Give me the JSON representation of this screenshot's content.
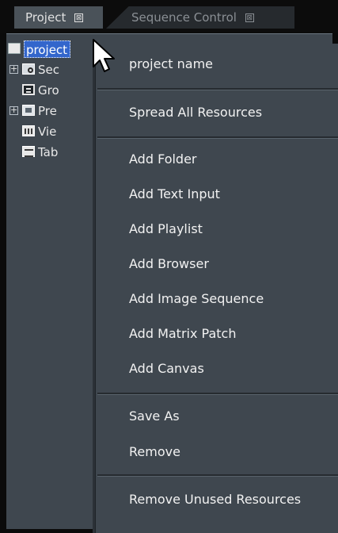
{
  "tabs": [
    {
      "label": "Project",
      "close": "⊠"
    },
    {
      "label": "Sequence Control",
      "close": "⊠"
    }
  ],
  "tree": {
    "root": {
      "label": "project",
      "icon": "open-folder-icon"
    },
    "items": [
      {
        "label": "Sec",
        "icon": "sequence-icon",
        "expandable": true,
        "expander": "+"
      },
      {
        "label": "Gro",
        "icon": "group-icon",
        "expandable": false
      },
      {
        "label": "Pre",
        "icon": "preset-icon",
        "expandable": true,
        "expander": "+"
      },
      {
        "label": "Vie",
        "icon": "view-icon",
        "expandable": false
      },
      {
        "label": "Tab",
        "icon": "table-icon",
        "expandable": false
      }
    ]
  },
  "menu": {
    "header": "project name",
    "spread": "Spread All Resources",
    "add_items": [
      "Add Folder",
      "Add Text Input",
      "Add Playlist",
      "Add Browser",
      "Add Image Sequence",
      "Add Matrix Patch",
      "Add Canvas"
    ],
    "save_as": "Save As",
    "remove": "Remove",
    "remove_unused": "Remove Unused Resources"
  },
  "colors": {
    "panel": "#3f474f",
    "selection": "#3366cc",
    "background": "#0b0b0b"
  }
}
